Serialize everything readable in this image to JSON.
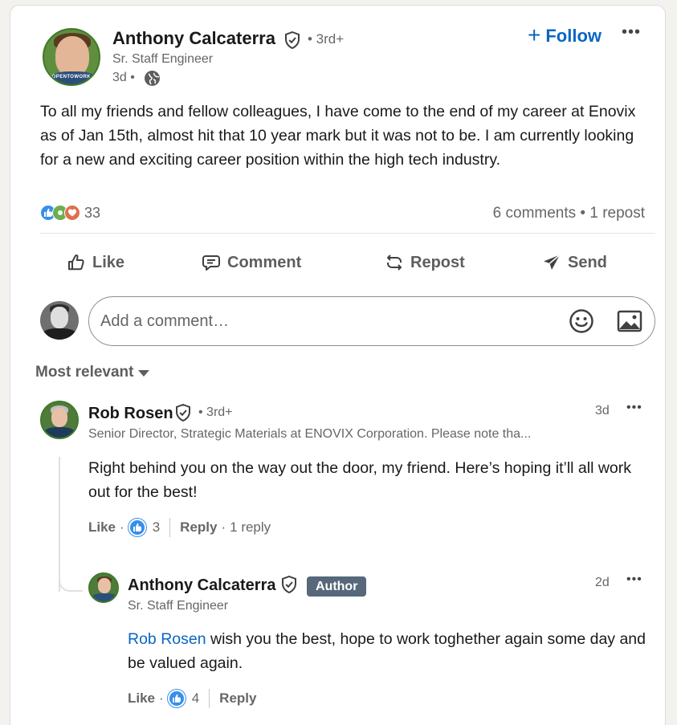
{
  "post": {
    "author_name": "Anthony Calcaterra",
    "degree": "• 3rd+",
    "headline": "Sr. Staff Engineer",
    "time": "3d •",
    "avatar_badge": "#OPENTOWORK",
    "follow_label": "Follow",
    "more_label": "•••",
    "text": "To all my friends and fellow colleagues, I have come to the end of my career at Enovix as of Jan 15th, almost hit that 10 year mark but it was not to be. I am currently looking for a new and exciting career position within the high tech industry.",
    "reaction_count": "33",
    "social_counts": "6 comments • 1 repost"
  },
  "actions": {
    "like": "Like",
    "comment": "Comment",
    "repost": "Repost",
    "send": "Send"
  },
  "comment_box": {
    "placeholder": "Add a comment…"
  },
  "sort": {
    "label": "Most relevant"
  },
  "comments": [
    {
      "name": "Rob Rosen",
      "degree": "• 3rd+",
      "headline": "Senior Director, Strategic Materials at ENOVIX Corporation. Please note tha...",
      "time": "3d",
      "text": "Right behind you on the way out the door, my friend. Here’s hoping it’ll all work out for the best!",
      "like_label": "Like",
      "like_count": "3",
      "reply_label": "Reply",
      "replies_label": "1 reply"
    }
  ],
  "reply": {
    "name": "Anthony Calcaterra",
    "author_badge": "Author",
    "headline": "Sr. Staff Engineer",
    "time": "2d",
    "mention": "Rob Rosen",
    "text": " wish you the best, hope to work toghether again some day and be valued again.",
    "like_label": "Like",
    "like_count": "4",
    "reply_label": "Reply"
  },
  "colors": {
    "accent_blue": "#0a66c2",
    "like_blue": "#378fe9",
    "muted_text": "#666666",
    "author_badge_bg": "#56687a",
    "opentowork_green": "#3f7a2a"
  },
  "icons": [
    "verified-shield-icon",
    "globe-icon",
    "plus-icon",
    "more-horizontal-icon",
    "like-thumb-icon",
    "comment-bubble-icon",
    "repost-icon",
    "send-icon",
    "emoji-icon",
    "image-icon",
    "caret-down-icon"
  ]
}
